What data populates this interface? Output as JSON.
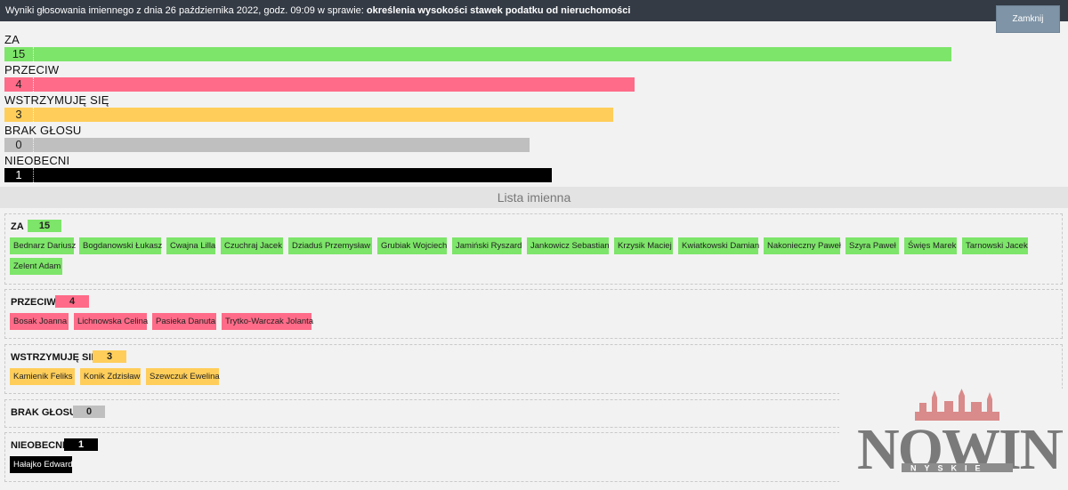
{
  "header": {
    "title_prefix": "Wyniki głosowania imiennego z dnia 26 października 2022, godz. 09:09 w sprawie: ",
    "title_subject": "określenia wysokości stawek podatku od nieruchomości",
    "close_label": "Zamknij"
  },
  "colors": {
    "za": "#7de569",
    "przeciw": "#ff6b88",
    "wstrzymuje": "#ffce5a",
    "brak": "#bfbfbf",
    "nieobecni": "#000000"
  },
  "summary": [
    {
      "label": "ZA",
      "count": "15",
      "fraction": 0.894
    },
    {
      "label": "PRZECIW",
      "count": "4",
      "fraction": 0.595
    },
    {
      "label": "WSTRZYMUJĘ SIĘ",
      "count": "3",
      "fraction": 0.575
    },
    {
      "label": "BRAK GŁOSU",
      "count": "0",
      "fraction": 0.496
    },
    {
      "label": "NIEOBECNI",
      "count": "1",
      "fraction": 0.517
    }
  ],
  "lista_title": "Lista imienna",
  "groups": [
    {
      "label": "ZA",
      "count": "15",
      "names": [
        "Bednarz Dariusz",
        "Bogdanowski Łukasz",
        "Cwajna Lilla",
        "Czuchraj Jacek",
        "Dziaduś Przemysław",
        "Grubiak Wojciech",
        "Jamiński Ryszard",
        "Jankowicz Sebastian",
        "Krzysik Maciej",
        "Kwiatkowski Damian",
        "Nakonieczny Paweł",
        "Szyra Paweł",
        "Święs Marek",
        "Tarnowski Jacek",
        "Zelent Adam"
      ]
    },
    {
      "label": "PRZECIW",
      "count": "4",
      "names": [
        "Bosak Joanna",
        "Lichnowska Celina",
        "Pasieka Danuta",
        "Trytko-Warczak Jolanta"
      ]
    },
    {
      "label": "WSTRZYMUJĘ SIĘ",
      "count": "3",
      "names": [
        "Kamienik Feliks",
        "Konik Zdzisław",
        "Szewczuk Ewelina"
      ]
    },
    {
      "label": "BRAK GŁOSU",
      "count": "0",
      "names": []
    },
    {
      "label": "NIEOBECNI",
      "count": "1",
      "names": [
        "Hałajko Edward"
      ]
    }
  ],
  "logo": {
    "text": "NOWINY",
    "subtext": "NYSKIE"
  }
}
